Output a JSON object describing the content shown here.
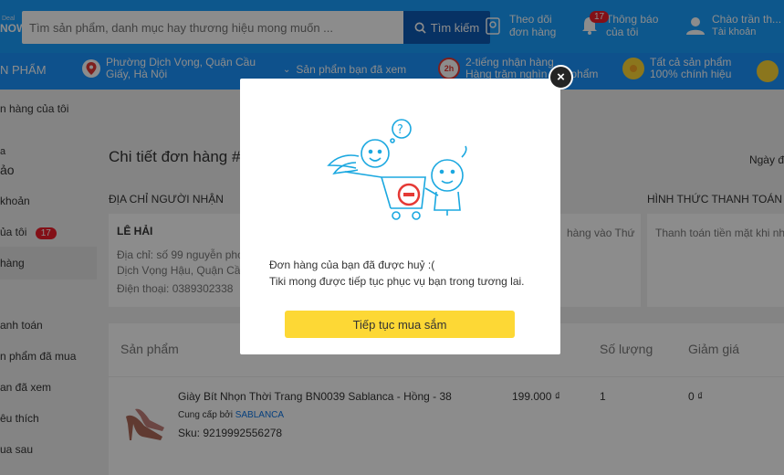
{
  "header": {
    "logo_small": "Deal",
    "logo_main": "NOW",
    "search_placeholder": "Tìm sản phẩm, danh mục hay thương hiệu mong muốn ...",
    "search_button": "Tìm kiếm",
    "track_order_line1": "Theo dõi",
    "track_order_line2": "đơn hàng",
    "notif_line1": "Thông báo",
    "notif_line2": "của tôi",
    "notif_count": "17",
    "account_line1": "Chào trần th...",
    "account_line2": "Tài khoản"
  },
  "navbar": {
    "category": "N PHẨM",
    "location_line1": "Phường Dịch Vọng, Quận Cầu",
    "location_line2": "Giấy, Hà Nội",
    "viewed": "Sản phẩm bạn đã xem",
    "delivery_line1": "2-tiếng nhận hàng",
    "delivery_line2": "Hàng trăm nghìn sản phẩm",
    "all_products_line1": "Tất cả sản phẩm",
    "all_products_line2": "100% chính hiệu"
  },
  "sidebar": {
    "breadcrumb": "n hàng của tôi",
    "user_small": "a",
    "user_name": "ảo",
    "items": [
      {
        "label": "khoản"
      },
      {
        "label": "ủa tôi",
        "badge": "17"
      },
      {
        "label": "hàng"
      },
      {
        "label": "anh toán"
      },
      {
        "label": "n phẩm đã mua"
      },
      {
        "label": "an đã xem"
      },
      {
        "label": "êu thích"
      },
      {
        "label": "ua sau"
      }
    ]
  },
  "order": {
    "title": "Chi tiết đơn hàng #",
    "date_label": "Ngày đ",
    "address_heading": "ĐỊA CHỈ NGƯỜI NHẬN",
    "payment_heading": "HÌNH THỨC THANH TOÁN",
    "receiver_name": "LÊ HẢI",
    "receiver_address_1": "Địa chỉ: số 99 nguyễn phon",
    "receiver_address_2": "Dịch Vọng Hậu, Quận Cầu",
    "receiver_phone": "Điện thoại: 0389302338",
    "delivery_note": "hàng vào Thứ",
    "payment_method": "Thanh toán tiền mặt khi nh"
  },
  "table": {
    "headers": {
      "product": "Sản phẩm",
      "qty": "Số lượng",
      "discount": "Giảm giá"
    },
    "row": {
      "name": "Giày Bít Nhọn Thời Trang BN0039 Sablanca - Hồng - 38",
      "supplier_prefix": "Cung cấp bởi",
      "supplier": "SABLANCA",
      "sku": "Sku: 9219992556278",
      "price": "199.000 ₫",
      "qty": "1",
      "discount": "0 ₫"
    }
  },
  "modal": {
    "message_line1": "Đơn hàng của bạn đã được huỷ :(",
    "message_line2": "Tiki mong được tiếp tục phục vụ bạn trong tương lai.",
    "button": "Tiếp tục mua sắm",
    "close": "×"
  },
  "colors": {
    "header_blue": "#189eff",
    "search_button": "#0d5cb6",
    "cta_yellow": "#fdd835",
    "badge_red": "#ef1e2b",
    "link_blue": "#0b74e5"
  }
}
